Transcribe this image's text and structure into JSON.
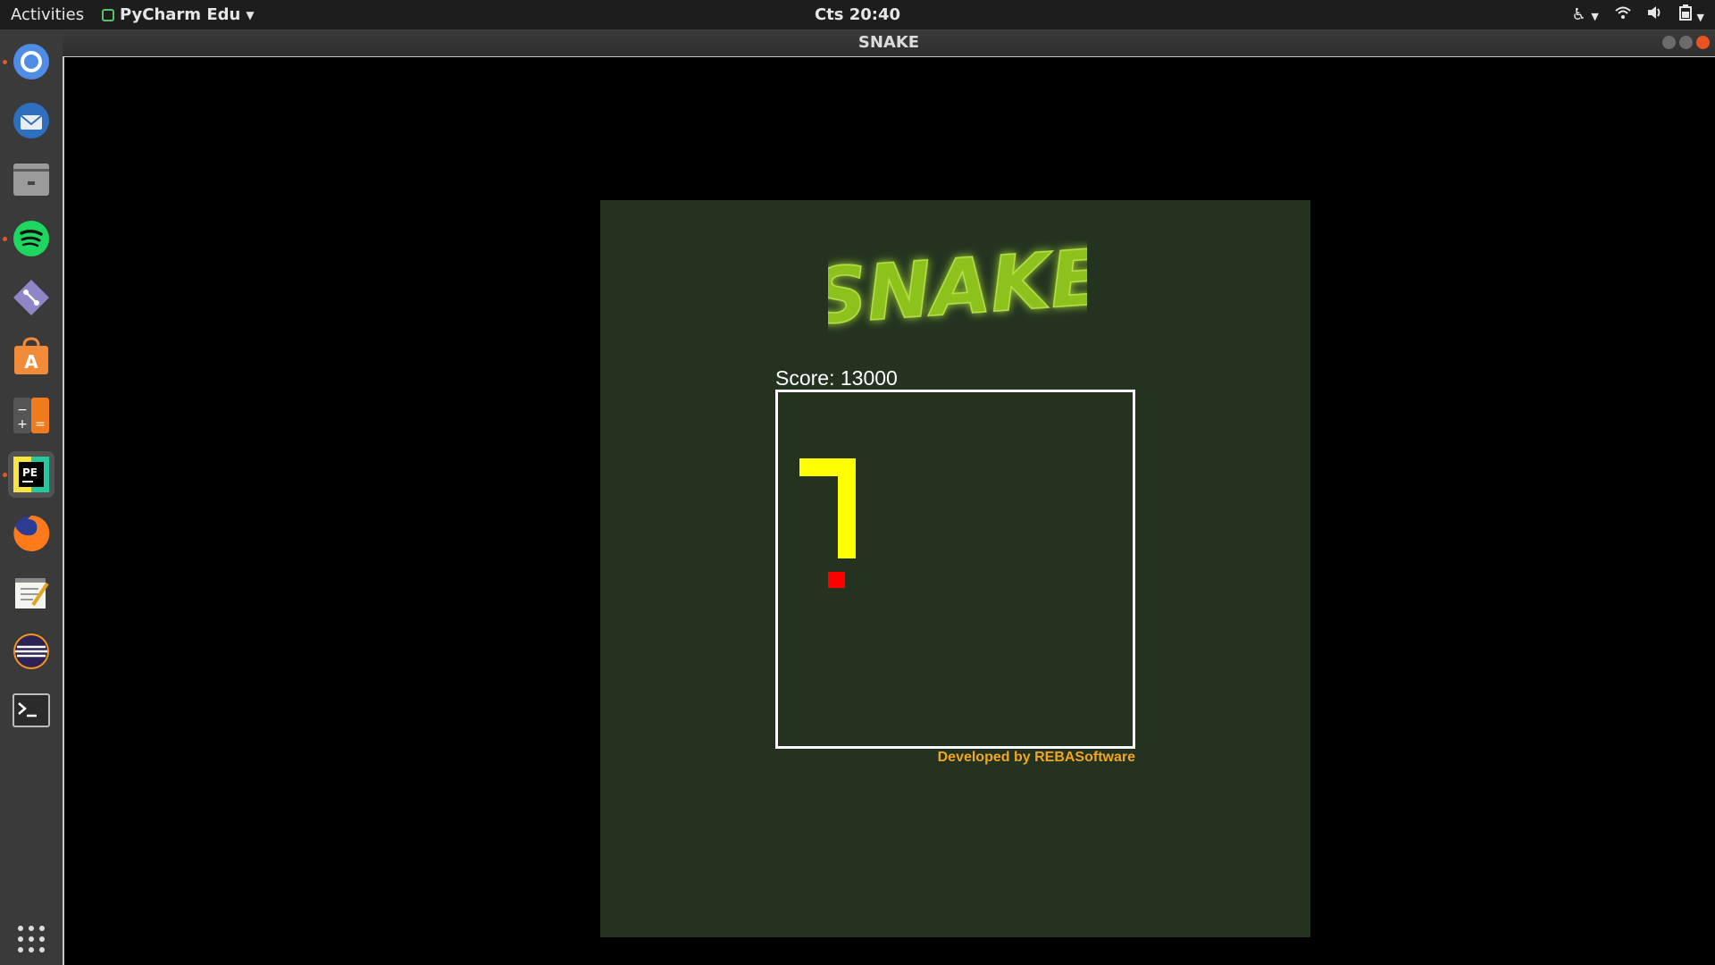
{
  "topbar": {
    "activities": "Activities",
    "app_name": "PyCharm Edu",
    "clock": "Cts 20:40"
  },
  "dock": {
    "items": [
      {
        "name": "chromium",
        "icon": "chromium-icon",
        "running": true
      },
      {
        "name": "thunderbird",
        "icon": "thunderbird-icon",
        "running": false
      },
      {
        "name": "files",
        "icon": "files-icon",
        "running": false
      },
      {
        "name": "spotify",
        "icon": "spotify-icon",
        "running": true
      },
      {
        "name": "git",
        "icon": "git-icon",
        "running": false
      },
      {
        "name": "software",
        "icon": "software-center-icon",
        "running": false
      },
      {
        "name": "calculator",
        "icon": "calculator-icon",
        "running": false
      },
      {
        "name": "pycharm-edu",
        "icon": "pycharm-edu-icon",
        "running": true,
        "active": true
      },
      {
        "name": "firefox",
        "icon": "firefox-icon",
        "running": false
      },
      {
        "name": "text-editor",
        "icon": "text-editor-icon",
        "running": false
      },
      {
        "name": "eclipse",
        "icon": "eclipse-icon",
        "running": false
      },
      {
        "name": "terminal",
        "icon": "terminal-icon",
        "running": false
      }
    ],
    "show_apps_icon": "app-grid-icon"
  },
  "window": {
    "title": "SNAKE"
  },
  "game": {
    "logo_text": "SNAKE",
    "score_label": "Score: 13000",
    "credits": "Developed by REBASoftware",
    "colors": {
      "panel": "#233320",
      "snake": "#ffff00",
      "food": "#ff0000",
      "board_border": "#ffffff",
      "credits": "#f2a521",
      "logo": "#8dc21f"
    }
  }
}
